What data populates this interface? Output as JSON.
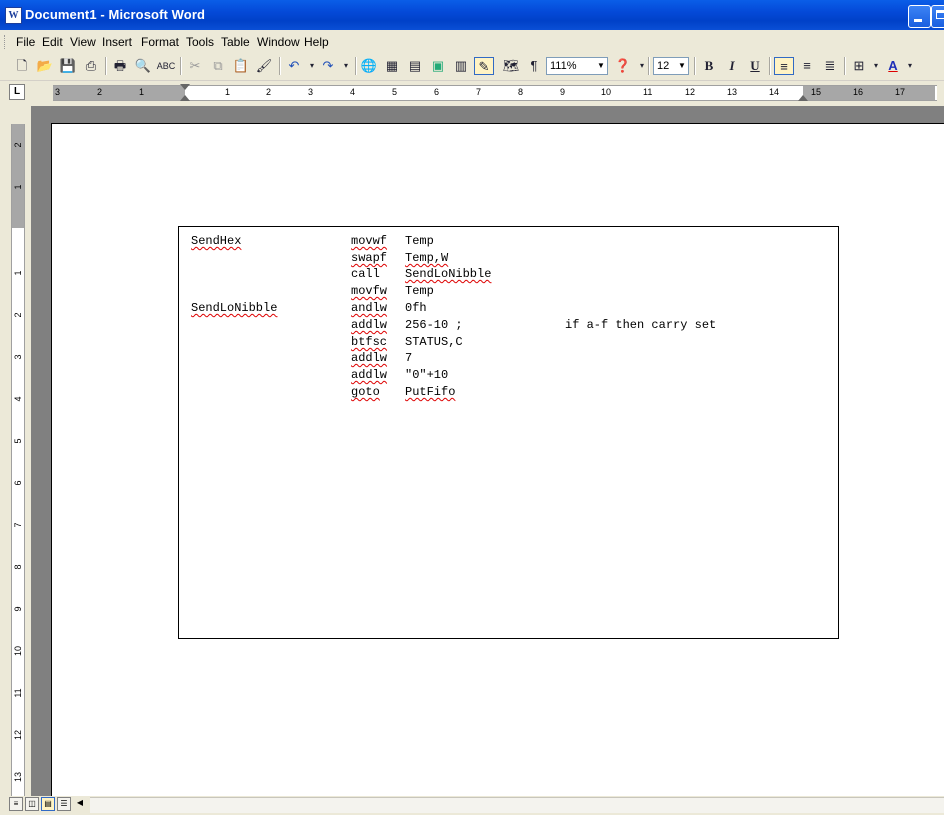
{
  "window": {
    "title": "Document1 - Microsoft Word",
    "app_icon": "W"
  },
  "menu": [
    "File",
    "Edit",
    "View",
    "Insert",
    "Format",
    "Tools",
    "Table",
    "Window",
    "Help"
  ],
  "toolbar": {
    "zoom": "111%",
    "font_size": "12",
    "bold": "B",
    "italic": "I",
    "underline": "U",
    "font_color_glyph": "A",
    "pilcrow": "¶"
  },
  "ruler": {
    "h_numbers": [
      "3",
      "2",
      "1",
      "1",
      "2",
      "3",
      "4",
      "5",
      "6",
      "7",
      "8",
      "9",
      "10",
      "11",
      "12",
      "13",
      "14",
      "15",
      "16",
      "17"
    ],
    "v_numbers": [
      "2",
      "1",
      "1",
      "2",
      "3",
      "4",
      "5",
      "6",
      "7",
      "8",
      "9",
      "10",
      "11",
      "12",
      "13"
    ]
  },
  "code": {
    "labels": [
      "SendHex",
      "SendLoNibble"
    ],
    "lines": [
      {
        "op": "movwf",
        "arg": "Temp",
        "comment": ""
      },
      {
        "op": "swapf",
        "arg": "Temp,W",
        "comment": ""
      },
      {
        "op": "call",
        "arg": "SendLoNibble",
        "comment": ""
      },
      {
        "op": "movfw",
        "arg": "Temp",
        "comment": ""
      },
      {
        "op": "andlw",
        "arg": "0fh",
        "comment": ""
      },
      {
        "op": "addlw",
        "arg": "256-10 ;",
        "comment": "if a-f then carry set"
      },
      {
        "op": "btfsc",
        "arg": "STATUS,C",
        "comment": ""
      },
      {
        "op": "addlw",
        "arg": "7",
        "comment": ""
      },
      {
        "op": "addlw",
        "arg": "\"0\"+10",
        "comment": ""
      },
      {
        "op": "goto",
        "arg": "PutFifo",
        "comment": ""
      }
    ]
  }
}
